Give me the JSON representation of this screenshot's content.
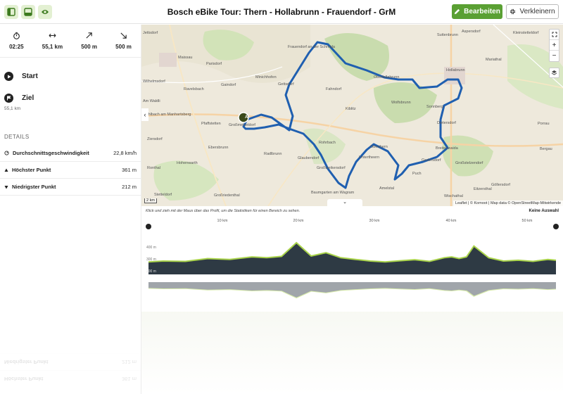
{
  "header": {
    "title": "Bosch eBike Tour: Thern - Hollabrunn - Frauendorf - GrM",
    "edit_label": "Bearbeiten",
    "shrink_label": "Verkleinern",
    "view_buttons": [
      "sidebar-view-icon",
      "split-view-icon",
      "eye-icon"
    ],
    "accent": "#5aa033"
  },
  "stats": {
    "duration": "02:25",
    "distance": "55,1 km",
    "ascent": "500 m",
    "descent": "500 m"
  },
  "waypoints": {
    "start": "Start",
    "end": "Ziel",
    "end_distance": "55,1 km"
  },
  "details": {
    "heading": "DETAILS",
    "rows": [
      {
        "label": "Durchschnittsgeschwindigkeit",
        "value": "22,8 km/h"
      },
      {
        "label": "Höchster Punkt",
        "value": "361 m"
      },
      {
        "label": "Niedrigster Punkt",
        "value": "212 m"
      }
    ]
  },
  "map": {
    "places": [
      "Frauendorf an der Schmida",
      "Maissau",
      "Aspersdorf",
      "Suttenbrunn",
      "Kleinstetteldorf",
      "Hollabrunn",
      "Oberfellabrunn",
      "Mariathal",
      "Minichhofen",
      "Gaindorf",
      "Wilhelmsdorf",
      "Parisdorf",
      "Ravelsbach",
      "Fahndorf",
      "Kiblitz",
      "Wolfsbrunn",
      "Sonnberg",
      "Porrau",
      "Pfaffstetten",
      "Großmeiseldorf",
      "Rohrbach",
      "Dietersdorf",
      "Ebersbrunn",
      "Breitenwaida",
      "Bergau",
      "Radlbrunn",
      "Glaubendorf",
      "Oberthern",
      "Untertheern",
      "Großstelzendorf",
      "Puch",
      "Hohenwarth",
      "Gettsdorf",
      "Ronthal",
      "Göllersdorf",
      "Eitzersthal",
      "Amelstal",
      "Stetteldorf",
      "Großriedenthal",
      "Baumgarten am Wagram",
      "Wischathal",
      "Ziersdorf",
      "Gedersdorf",
      "Großweikersdorf",
      "Mühlbach am Manhartsberg",
      "Am Waldli",
      "Jettsdorf"
    ],
    "scale_label": "2 km",
    "attribution": "Leaflet | © Komoot | Map data © OpenStreetMap-Mitwirkende",
    "start_marker": "A",
    "route_color": "#1f5fb0"
  },
  "profile": {
    "hint": "Klick und zieh mit der Maus über das Profil, um die Statistiken für einen Bereich zu sehen.",
    "selection": "Keine Auswahl",
    "km_ticks": [
      "10 km",
      "20 km",
      "30 km",
      "40 km",
      "50 km"
    ],
    "y_labels": [
      "400 m",
      "300 m",
      "200 m"
    ]
  },
  "chart_data": {
    "type": "area",
    "x": [
      0,
      2,
      5,
      8,
      11,
      14,
      16,
      18,
      20,
      22,
      24,
      26,
      28,
      30,
      32,
      34,
      36,
      38,
      40,
      41,
      42,
      43,
      44,
      46,
      48,
      50,
      52,
      54,
      55.1
    ],
    "y": [
      225,
      230,
      228,
      245,
      240,
      255,
      250,
      258,
      340,
      260,
      280,
      250,
      240,
      230,
      225,
      232,
      238,
      228,
      250,
      255,
      245,
      255,
      320,
      250,
      230,
      235,
      228,
      240,
      235
    ],
    "xlabel": "",
    "ylabel": "",
    "ylim": [
      150,
      420
    ],
    "xlim": [
      0,
      55.1
    ],
    "grid": false
  }
}
